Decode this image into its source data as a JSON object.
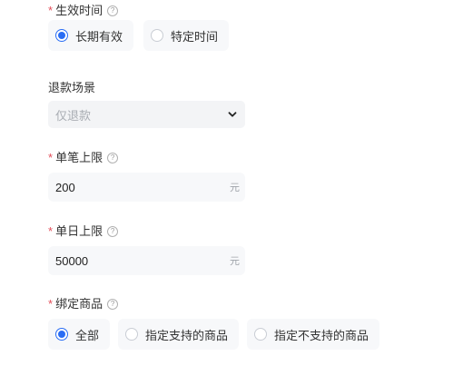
{
  "help_glyph": "?",
  "validity": {
    "required_mark": "*",
    "label": "生效时间",
    "options": [
      "长期有效",
      "特定时间"
    ],
    "selected_index": 0
  },
  "refund_scene": {
    "label": "退款场景",
    "value": "仅退款"
  },
  "single_limit": {
    "required_mark": "*",
    "label": "单笔上限",
    "value": "200",
    "unit": "元"
  },
  "daily_limit": {
    "required_mark": "*",
    "label": "单日上限",
    "value": "50000",
    "unit": "元"
  },
  "bind_goods": {
    "required_mark": "*",
    "label": "绑定商品",
    "options": [
      "全部",
      "指定支持的商品",
      "指定不支持的商品"
    ],
    "selected_index": 0
  }
}
